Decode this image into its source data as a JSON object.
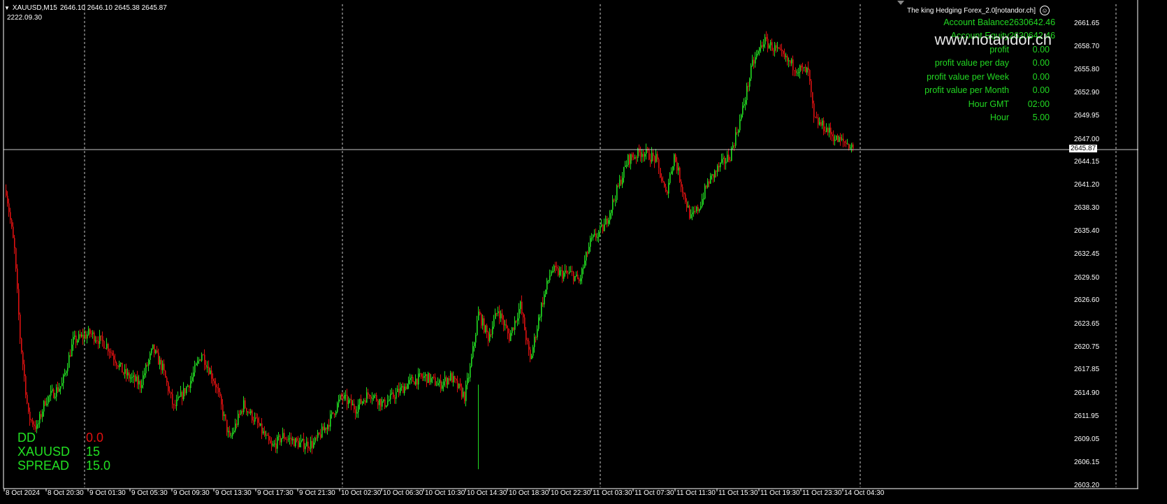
{
  "header": {
    "symbol": "XAUUSD,M15",
    "ohlc": "2646.10 2646.10 2645.38 2645.87",
    "time": "2222.09.30"
  },
  "ea": {
    "title": "The king Hedging Forex_2.0[notandor.ch]",
    "watermark": "www.notandor.ch",
    "rows": [
      {
        "label": "Account Balance",
        "value": "2630642.46"
      },
      {
        "label": "Account Equity",
        "value": "2630642.46"
      },
      {
        "label": "profit",
        "value": "0.00"
      },
      {
        "label": "profit value per day",
        "value": "0.00"
      },
      {
        "label": "profit value per Week",
        "value": "0.00"
      },
      {
        "label": "profit value per Month",
        "value": "0.00"
      },
      {
        "label": "Hour GMT",
        "value": "02:00"
      },
      {
        "label": "Hour",
        "value": "5.00"
      }
    ]
  },
  "stats": [
    {
      "key": "DD",
      "value": "0.0"
    },
    {
      "key": "XAUUSD",
      "value": "15"
    },
    {
      "key": "SPREAD",
      "value": "15.0"
    }
  ],
  "price_axis": {
    "ticks": [
      "2661.65",
      "2658.70",
      "2655.80",
      "2652.90",
      "2649.95",
      "2647.00",
      "2644.15",
      "2641.20",
      "2638.30",
      "2635.40",
      "2632.45",
      "2629.50",
      "2626.60",
      "2623.65",
      "2620.75",
      "2617.85",
      "2614.90",
      "2611.95",
      "2609.05",
      "2606.15",
      "2603.20"
    ],
    "current": "2645.87"
  },
  "time_axis": [
    "8 Oct 2024",
    "8 Oct 20:30",
    "9 Oct 01:30",
    "9 Oct 05:30",
    "9 Oct 09:30",
    "9 Oct 13:30",
    "9 Oct 17:30",
    "9 Oct 21:30",
    "10 Oct 02:30",
    "10 Oct 06:30",
    "10 Oct 10:30",
    "10 Oct 14:30",
    "10 Oct 18:30",
    "10 Oct 22:30",
    "11 Oct 03:30",
    "11 Oct 07:30",
    "11 Oct 11:30",
    "11 Oct 15:30",
    "11 Oct 19:30",
    "11 Oct 23:30",
    "14 Oct 04:30"
  ],
  "colors": {
    "bull": "#22dd22",
    "bear": "#dd1111",
    "grid": "#c8c8c8",
    "background": "#000000"
  },
  "chart_data": {
    "type": "candlestick",
    "symbol": "XAUUSD",
    "timeframe": "M15",
    "ylim": [
      2603.2,
      2661.65
    ],
    "path": [
      {
        "i": 0,
        "p": 2640.6
      },
      {
        "i": 6,
        "p": 2633.0
      },
      {
        "i": 10,
        "p": 2622.0
      },
      {
        "i": 16,
        "p": 2612.0
      },
      {
        "i": 22,
        "p": 2610.5
      },
      {
        "i": 28,
        "p": 2614.0
      },
      {
        "i": 40,
        "p": 2616.0
      },
      {
        "i": 48,
        "p": 2621.5
      },
      {
        "i": 60,
        "p": 2622.5
      },
      {
        "i": 72,
        "p": 2621.0
      },
      {
        "i": 84,
        "p": 2617.5
      },
      {
        "i": 96,
        "p": 2616.0
      },
      {
        "i": 105,
        "p": 2620.5
      },
      {
        "i": 112,
        "p": 2618.0
      },
      {
        "i": 120,
        "p": 2613.0
      },
      {
        "i": 132,
        "p": 2616.5
      },
      {
        "i": 140,
        "p": 2620.0
      },
      {
        "i": 150,
        "p": 2616.0
      },
      {
        "i": 160,
        "p": 2609.0
      },
      {
        "i": 170,
        "p": 2613.5
      },
      {
        "i": 180,
        "p": 2611.0
      },
      {
        "i": 190,
        "p": 2608.0
      },
      {
        "i": 198,
        "p": 2609.5
      },
      {
        "i": 210,
        "p": 2608.5
      },
      {
        "i": 220,
        "p": 2608.5
      },
      {
        "i": 230,
        "p": 2611.0
      },
      {
        "i": 240,
        "p": 2614.5
      },
      {
        "i": 250,
        "p": 2613.0
      },
      {
        "i": 260,
        "p": 2615.0
      },
      {
        "i": 270,
        "p": 2613.5
      },
      {
        "i": 280,
        "p": 2615.0
      },
      {
        "i": 290,
        "p": 2616.5
      },
      {
        "i": 300,
        "p": 2617.0
      },
      {
        "i": 310,
        "p": 2616.0
      },
      {
        "i": 318,
        "p": 2617.0
      },
      {
        "i": 328,
        "p": 2614.5
      },
      {
        "i": 332,
        "p": 2618.0
      },
      {
        "i": 338,
        "p": 2625.0
      },
      {
        "i": 345,
        "p": 2622.0
      },
      {
        "i": 352,
        "p": 2625.5
      },
      {
        "i": 360,
        "p": 2622.0
      },
      {
        "i": 368,
        "p": 2626.0
      },
      {
        "i": 375,
        "p": 2619.0
      },
      {
        "i": 383,
        "p": 2626.0
      },
      {
        "i": 390,
        "p": 2630.5
      },
      {
        "i": 398,
        "p": 2630.0
      },
      {
        "i": 405,
        "p": 2630.0
      },
      {
        "i": 410,
        "p": 2629.0
      },
      {
        "i": 418,
        "p": 2634.0
      },
      {
        "i": 428,
        "p": 2636.0
      },
      {
        "i": 436,
        "p": 2640.0
      },
      {
        "i": 445,
        "p": 2644.5
      },
      {
        "i": 455,
        "p": 2645.5
      },
      {
        "i": 465,
        "p": 2644.5
      },
      {
        "i": 472,
        "p": 2640.0
      },
      {
        "i": 478,
        "p": 2645.0
      },
      {
        "i": 485,
        "p": 2640.0
      },
      {
        "i": 490,
        "p": 2637.0
      },
      {
        "i": 496,
        "p": 2638.5
      },
      {
        "i": 502,
        "p": 2641.5
      },
      {
        "i": 510,
        "p": 2643.5
      },
      {
        "i": 518,
        "p": 2645.0
      },
      {
        "i": 526,
        "p": 2650.0
      },
      {
        "i": 534,
        "p": 2656.5
      },
      {
        "i": 542,
        "p": 2659.5
      },
      {
        "i": 550,
        "p": 2658.5
      },
      {
        "i": 558,
        "p": 2657.0
      },
      {
        "i": 566,
        "p": 2656.0
      },
      {
        "i": 574,
        "p": 2655.5
      },
      {
        "i": 578,
        "p": 2649.5
      },
      {
        "i": 586,
        "p": 2648.5
      },
      {
        "i": 594,
        "p": 2647.0
      },
      {
        "i": 602,
        "p": 2646.5
      },
      {
        "i": 606,
        "p": 2645.87
      }
    ]
  }
}
